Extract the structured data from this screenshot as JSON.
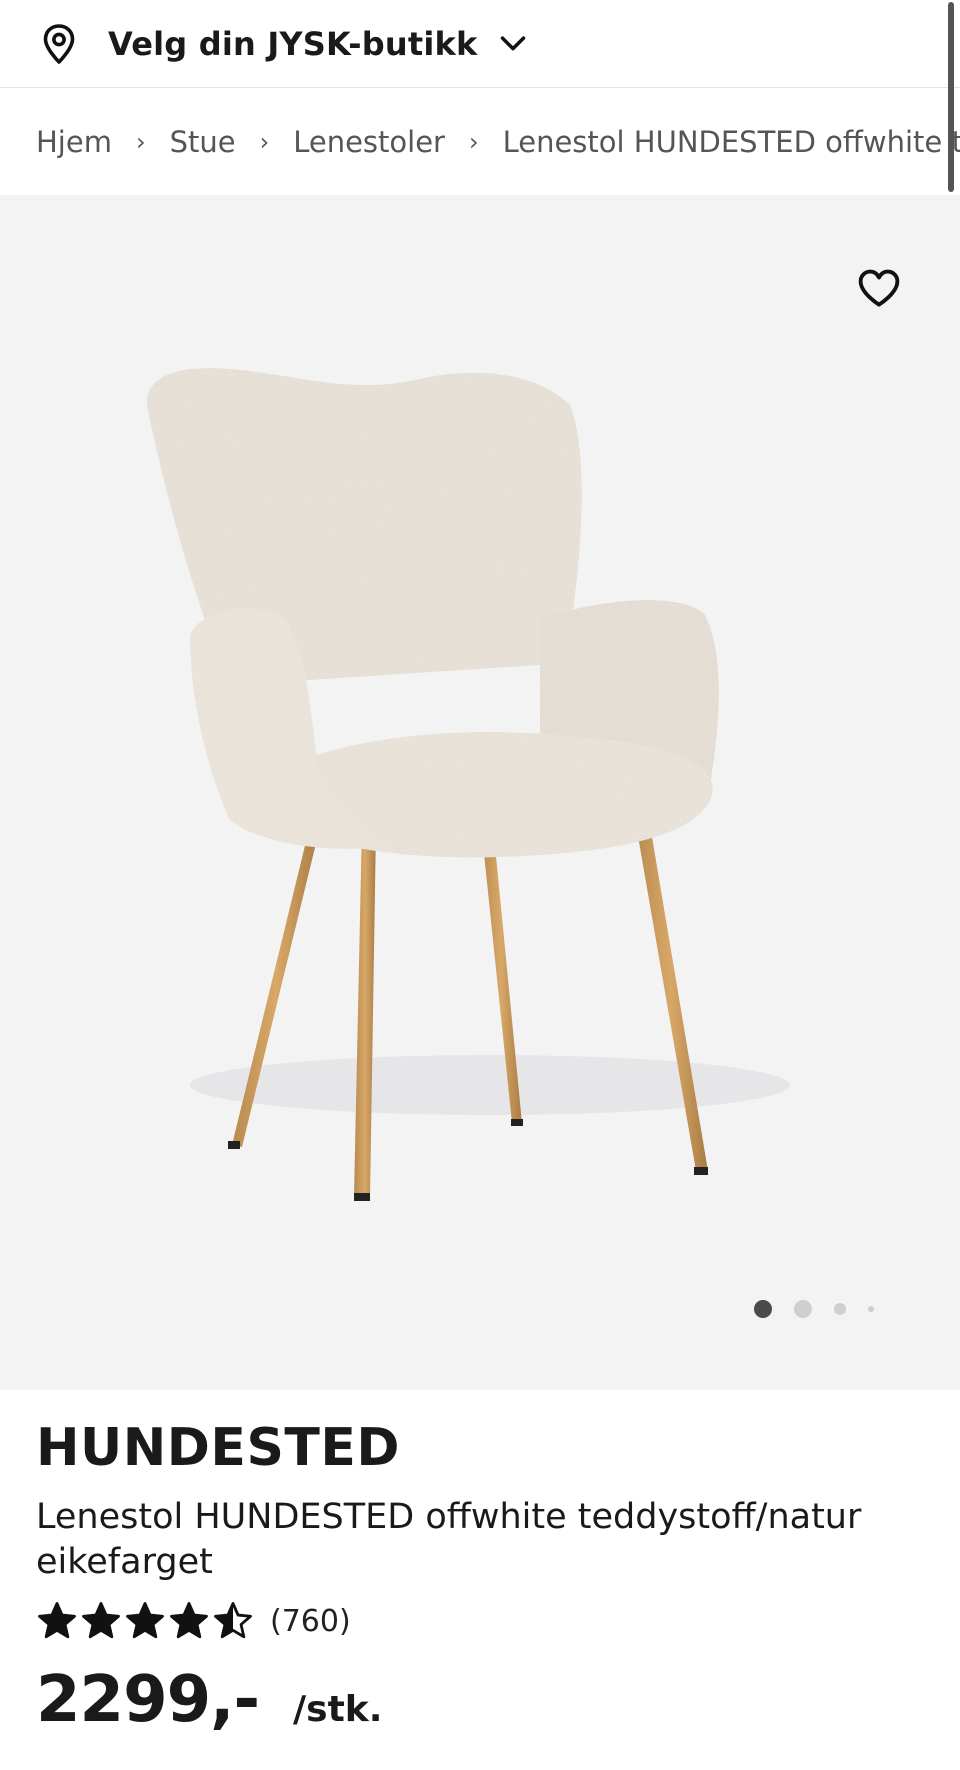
{
  "store_bar": {
    "icon": "location-pin-icon",
    "label": "Velg din JYSK-butikk",
    "dropdown_icon": "chevron-down-icon"
  },
  "breadcrumb": {
    "items": [
      "Hjem",
      "Stue",
      "Lenestoler",
      "Lenestol HUNDESTED offwhite teddystoff/natur eikefarget"
    ],
    "separator": "›"
  },
  "gallery": {
    "favorite_icon": "heart-outline-icon",
    "image": "armchair-product-photo",
    "image_count": 4,
    "active_index": 0
  },
  "product": {
    "brand": "HUNDESTED",
    "title": "Lenestol HUNDESTED offwhite teddystoff/natur eikefarget",
    "rating": 4.5,
    "rating_max": 5,
    "review_count": "(760)",
    "price": "2299,-",
    "unit": "/stk."
  },
  "colors": {
    "gallery_bg": "#f3f3f4",
    "text": "#1a1a1a",
    "muted": "#555555"
  }
}
